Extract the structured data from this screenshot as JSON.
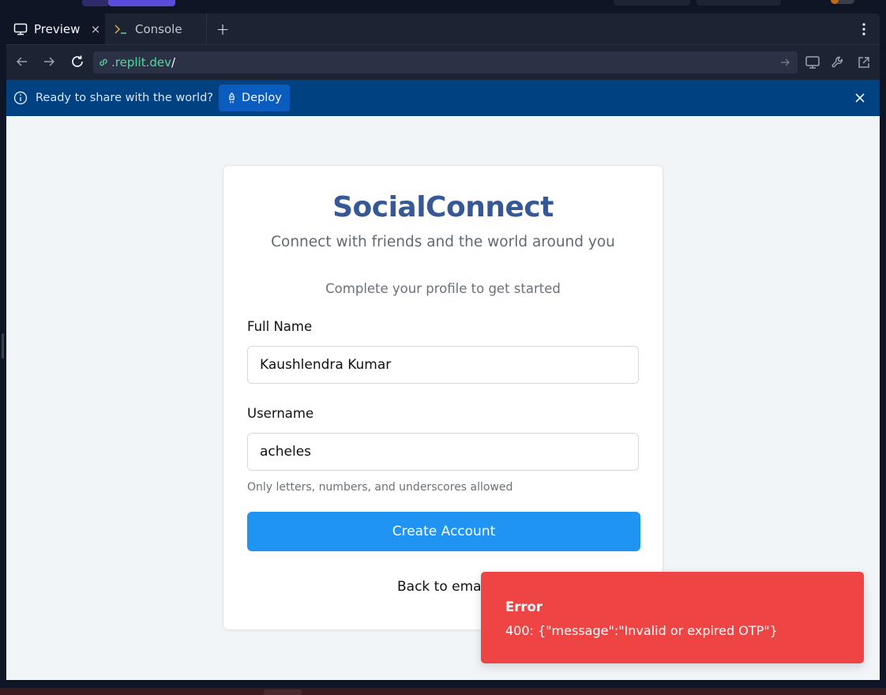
{
  "browser": {
    "tabs": [
      {
        "label": "Preview",
        "icon": "monitor-icon",
        "close": "×"
      },
      {
        "label": "Console",
        "icon": "terminal-icon"
      }
    ],
    "new_tab": "+",
    "url_host": ".replit.dev",
    "url_path": "/"
  },
  "banner": {
    "text": "Ready to share with the world?",
    "deploy_label": "Deploy"
  },
  "app": {
    "brand": "SocialConnect",
    "tagline": "Connect with friends and the world around you",
    "subtitle": "Complete your profile to get started",
    "full_name_label": "Full Name",
    "full_name_value": "Kaushlendra Kumar",
    "username_label": "Username",
    "username_value": "acheles",
    "username_hint": "Only letters, numbers, and underscores allowed",
    "create_button": "Create Account",
    "back_link": "Back to email"
  },
  "toast": {
    "title": "Error",
    "message": "400: {\"message\":\"Invalid or expired OTP\"}"
  },
  "colors": {
    "brand": "#365897",
    "primary_button": "#2094f3",
    "error": "#ef4444",
    "banner": "#004182",
    "url_host": "#5bd6a0"
  }
}
